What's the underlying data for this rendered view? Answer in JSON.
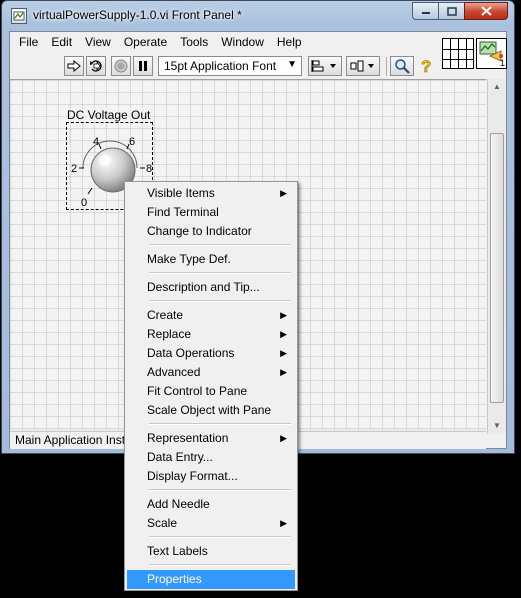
{
  "window": {
    "title": "virtualPowerSupply-1.0.vi Front Panel *",
    "icon": "labview-vi-icon"
  },
  "caption_buttons": {
    "minimize": "minimize-icon",
    "maximize": "maximize-icon",
    "close": "close-icon"
  },
  "menubar": [
    "File",
    "Edit",
    "View",
    "Operate",
    "Tools",
    "Window",
    "Help"
  ],
  "toolbar": {
    "run": "run-arrow-icon",
    "run_continuously": "run-continuously-icon",
    "abort": "abort-icon",
    "pause": "pause-icon",
    "font": "15pt Application Font",
    "align": "align-objects-icon",
    "distribute": "distribute-objects-icon",
    "search": "search-icon",
    "help": "context-help-icon",
    "connector_pane": "connector-pane-icon",
    "vi_icon_number": "1"
  },
  "knob": {
    "label": "DC Voltage Out",
    "scale_labels": [
      "0",
      "2",
      "4",
      "6",
      "8"
    ]
  },
  "status": {
    "text": "Main Application Instance"
  },
  "context_menu": {
    "items": [
      {
        "label": "Visible Items",
        "submenu": true
      },
      {
        "label": "Find Terminal",
        "submenu": false
      },
      {
        "label": "Change to Indicator",
        "submenu": false
      },
      {
        "label": "Make Type Def.",
        "submenu": false
      },
      {
        "label": "Description and Tip...",
        "submenu": false
      },
      {
        "label": "Create",
        "submenu": true
      },
      {
        "label": "Replace",
        "submenu": true
      },
      {
        "label": "Data Operations",
        "submenu": true
      },
      {
        "label": "Advanced",
        "submenu": true
      },
      {
        "label": "Fit Control to Pane",
        "submenu": false
      },
      {
        "label": "Scale Object with Pane",
        "submenu": false
      },
      {
        "label": "Representation",
        "submenu": true
      },
      {
        "label": "Data Entry...",
        "submenu": false
      },
      {
        "label": "Display Format...",
        "submenu": false
      },
      {
        "label": "Add Needle",
        "submenu": false
      },
      {
        "label": "Scale",
        "submenu": true
      },
      {
        "label": "Text Labels",
        "submenu": false
      },
      {
        "label": "Properties",
        "submenu": false,
        "selected": true
      }
    ]
  },
  "colors": {
    "selection": "#3399ff",
    "titlebar": "#b9cfe7",
    "close_button": "#c9452f"
  }
}
